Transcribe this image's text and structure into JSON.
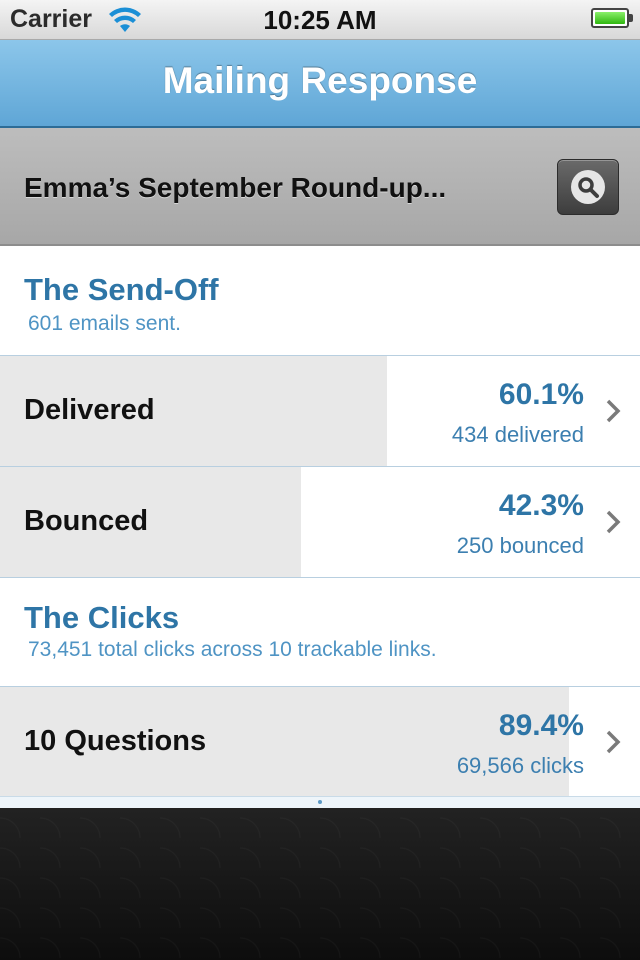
{
  "status": {
    "carrier": "Carrier",
    "time": "10:25 AM",
    "battery_level": 1.0
  },
  "navbar": {
    "title": "Mailing Response"
  },
  "header": {
    "mailing_name": "Emma’s September Round-up..."
  },
  "send_off": {
    "title": "The Send-Off",
    "subtitle": "601 emails sent."
  },
  "rows_sendoff": [
    {
      "label": "Delivered",
      "percent": "60.1%",
      "count": "434 delivered",
      "fill": 0.604
    },
    {
      "label": "Bounced",
      "percent": "42.3%",
      "count": "250 bounced",
      "fill": 0.47
    }
  ],
  "clicks": {
    "title": "The Clicks",
    "subtitle": "73,451 total clicks across 10 trackable links."
  },
  "rows_clicks": [
    {
      "label": "10 Questions",
      "percent": "89.4%",
      "count": "69,566 clicks",
      "fill": 0.889
    }
  ],
  "colors": {
    "accent": "#2e75a6",
    "navbar": "#6fb2de",
    "bar_fill": "#e8e8e8"
  },
  "icons": {
    "search": "magnifying-glass",
    "row_disclosure": "chevron-right",
    "wifi": "wifi"
  }
}
